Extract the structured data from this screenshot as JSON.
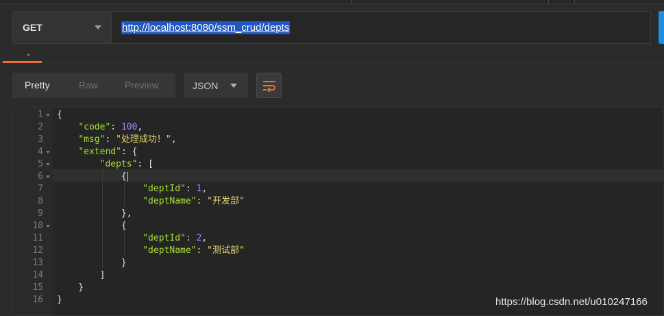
{
  "request": {
    "method": "GET",
    "url": "http://localhost:8080/ssm_crud/depts"
  },
  "response_toolbar": {
    "tabs": [
      {
        "label": "Pretty",
        "active": true
      },
      {
        "label": "Raw",
        "active": false
      },
      {
        "label": "Preview",
        "active": false
      }
    ],
    "format": "JSON",
    "wrap_icon": "wrap-lines-icon"
  },
  "body_lines": [
    {
      "no": "1",
      "fold": true,
      "tokens": [
        {
          "t": "p",
          "v": "{"
        }
      ]
    },
    {
      "no": "2",
      "fold": false,
      "tokens": [
        {
          "t": "p",
          "v": "    "
        },
        {
          "t": "k",
          "v": "\"code\""
        },
        {
          "t": "p",
          "v": ": "
        },
        {
          "t": "n",
          "v": "100"
        },
        {
          "t": "p",
          "v": ","
        }
      ]
    },
    {
      "no": "3",
      "fold": false,
      "tokens": [
        {
          "t": "p",
          "v": "    "
        },
        {
          "t": "k",
          "v": "\"msg\""
        },
        {
          "t": "p",
          "v": ": "
        },
        {
          "t": "s",
          "v": "\"处理成功！\""
        },
        {
          "t": "p",
          "v": ","
        }
      ]
    },
    {
      "no": "4",
      "fold": true,
      "tokens": [
        {
          "t": "p",
          "v": "    "
        },
        {
          "t": "k",
          "v": "\"extend\""
        },
        {
          "t": "p",
          "v": ": {"
        }
      ]
    },
    {
      "no": "5",
      "fold": true,
      "tokens": [
        {
          "t": "p",
          "v": "        "
        },
        {
          "t": "k",
          "v": "\"depts\""
        },
        {
          "t": "p",
          "v": ": ["
        }
      ]
    },
    {
      "no": "6",
      "fold": true,
      "tokens": [
        {
          "t": "p",
          "v": "            {"
        }
      ]
    },
    {
      "no": "7",
      "fold": false,
      "tokens": [
        {
          "t": "p",
          "v": "                "
        },
        {
          "t": "k",
          "v": "\"deptId\""
        },
        {
          "t": "p",
          "v": ": "
        },
        {
          "t": "n",
          "v": "1"
        },
        {
          "t": "p",
          "v": ","
        }
      ]
    },
    {
      "no": "8",
      "fold": false,
      "tokens": [
        {
          "t": "p",
          "v": "                "
        },
        {
          "t": "k",
          "v": "\"deptName\""
        },
        {
          "t": "p",
          "v": ": "
        },
        {
          "t": "s",
          "v": "\"开发部\""
        }
      ]
    },
    {
      "no": "9",
      "fold": false,
      "tokens": [
        {
          "t": "p",
          "v": "            },"
        }
      ]
    },
    {
      "no": "10",
      "fold": true,
      "tokens": [
        {
          "t": "p",
          "v": "            {"
        }
      ]
    },
    {
      "no": "11",
      "fold": false,
      "tokens": [
        {
          "t": "p",
          "v": "                "
        },
        {
          "t": "k",
          "v": "\"deptId\""
        },
        {
          "t": "p",
          "v": ": "
        },
        {
          "t": "n",
          "v": "2"
        },
        {
          "t": "p",
          "v": ","
        }
      ]
    },
    {
      "no": "12",
      "fold": false,
      "tokens": [
        {
          "t": "p",
          "v": "                "
        },
        {
          "t": "k",
          "v": "\"deptName\""
        },
        {
          "t": "p",
          "v": ": "
        },
        {
          "t": "s",
          "v": "\"测试部\""
        }
      ]
    },
    {
      "no": "13",
      "fold": false,
      "tokens": [
        {
          "t": "p",
          "v": "            }"
        }
      ]
    },
    {
      "no": "14",
      "fold": false,
      "tokens": [
        {
          "t": "p",
          "v": "        ]"
        }
      ]
    },
    {
      "no": "15",
      "fold": false,
      "tokens": [
        {
          "t": "p",
          "v": "    }"
        }
      ]
    },
    {
      "no": "16",
      "fold": false,
      "tokens": [
        {
          "t": "p",
          "v": "}"
        }
      ]
    }
  ],
  "watermark": "https://blog.csdn.net/u010247166",
  "colors": {
    "accent": "#f26b3a",
    "send": "#1a8fe3",
    "json_key": "#a6e22e",
    "json_string": "#e6db74",
    "json_number": "#ae81ff"
  }
}
